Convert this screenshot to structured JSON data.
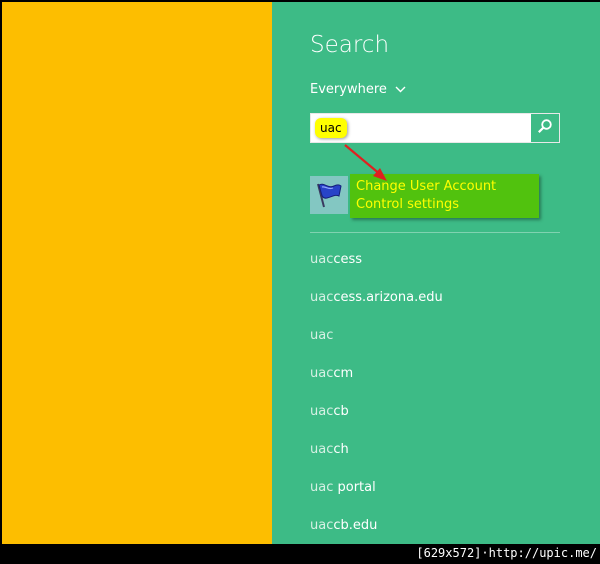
{
  "charm": {
    "title": "Search",
    "scope": "Everywhere",
    "query": "uac",
    "top_result": {
      "label": "Change User Account Control settings",
      "icon": "uac-flag-icon"
    },
    "suggestions": [
      {
        "typed": "uac",
        "rest": "cess"
      },
      {
        "typed": "uac",
        "rest": "cess.arizona.edu"
      },
      {
        "typed": "uac",
        "rest": ""
      },
      {
        "typed": "uac",
        "rest": "cm"
      },
      {
        "typed": "uac",
        "rest": "cb"
      },
      {
        "typed": "uac",
        "rest": "ch"
      },
      {
        "typed": "uac",
        "rest": " portal"
      },
      {
        "typed": "uac",
        "rest": "cb.edu"
      }
    ]
  },
  "annotation": {
    "highlight_text": "uac"
  },
  "watermark": "[629x572]·http://upic.me/",
  "colors": {
    "left_background": "#FDBE00",
    "charm_background": "#3DBB86",
    "callout_background": "#51C20E",
    "callout_text": "#FFFF00",
    "highlight_background": "#FFFF00",
    "arrow": "#E02020"
  }
}
